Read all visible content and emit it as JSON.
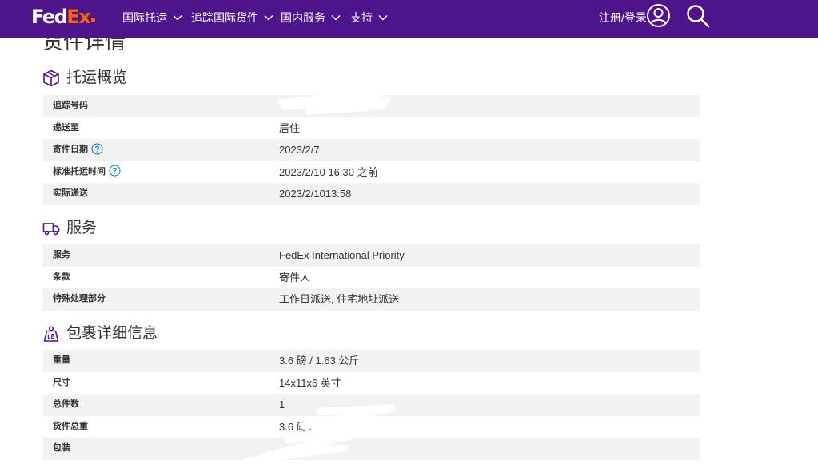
{
  "nav": {
    "logo_fed": "Fed",
    "logo_ex": "Ex",
    "menu": [
      {
        "label": "国际托运"
      },
      {
        "label": "追踪国际货件"
      },
      {
        "label": "国内服务"
      },
      {
        "label": "支持"
      }
    ],
    "login_label": "注册/登录",
    "icons": {
      "user": "user-circle-icon",
      "search": "search-icon",
      "menu_arrow": "chevron-down-icon"
    },
    "colors": {
      "bar": "#4d148c",
      "accent": "#ff6200"
    }
  },
  "page": {
    "title": "货件详情"
  },
  "overview": {
    "title": "托运概览",
    "icon": "package-box-icon",
    "rows": [
      {
        "label": "追踪号码",
        "value": ""
      },
      {
        "label": "递送至",
        "value": "居住"
      },
      {
        "label": "寄件日期",
        "value": "2023/2/7"
      },
      {
        "label": "标准托运时间",
        "value": "2023/2/10 16:30 之前"
      },
      {
        "label": "实际递送",
        "value": "2023/2/1013:58"
      }
    ]
  },
  "service": {
    "title": "服务",
    "icon": "delivery-truck-icon",
    "rows": [
      {
        "label": "服务",
        "value": "FedEx International Priority"
      },
      {
        "label": "条款",
        "value": "寄件人"
      },
      {
        "label": "特殊处理部分",
        "value": "工作日派送, 住宅地址派送"
      }
    ]
  },
  "package": {
    "title": "包裹详细信息",
    "icon": "weight-lb-icon",
    "rows": [
      {
        "label": "重量",
        "value": "3.6 磅 / 1.63 公斤"
      },
      {
        "label": "尺寸",
        "value": "14x11x6 英寸"
      },
      {
        "label": "总件数",
        "value": "1"
      },
      {
        "label": "货件总重",
        "value": "3.6 磅 /"
      },
      {
        "label": "包装",
        "value": ""
      }
    ]
  }
}
